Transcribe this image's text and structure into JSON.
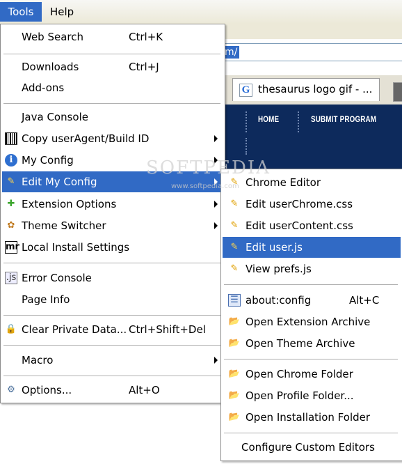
{
  "menubar": {
    "tools_label": "Tools",
    "help_label": "Help"
  },
  "background": {
    "url_fragment": "m/",
    "tab_label": "thesaurus logo gif - ...",
    "site_nav": [
      "HOME",
      "SUBMIT PROGRAM"
    ],
    "watermark": "SOFTPEDIA",
    "watermark_sub": "www.softpedia.com"
  },
  "tools_menu": {
    "items": [
      {
        "label": "Web Search",
        "shortcut": "Ctrl+K",
        "icon": "none"
      },
      {
        "label": "Downloads",
        "shortcut": "Ctrl+J",
        "icon": "none"
      },
      {
        "label": "Add-ons",
        "shortcut": "",
        "icon": "none"
      },
      {
        "label": "Java Console",
        "shortcut": "",
        "icon": "none"
      },
      {
        "label": "Copy userAgent/Build ID",
        "shortcut": "",
        "icon": "barcode-icon",
        "submenu": true
      },
      {
        "label": "My Config",
        "shortcut": "",
        "icon": "info-icon",
        "submenu": true
      },
      {
        "label": "Edit My Config",
        "shortcut": "",
        "icon": "pencil-icon",
        "submenu": true,
        "highlighted": true
      },
      {
        "label": "Extension Options",
        "shortcut": "",
        "icon": "puzzle-icon",
        "submenu": true
      },
      {
        "label": "Theme Switcher",
        "shortcut": "",
        "icon": "palette-icon",
        "submenu": true
      },
      {
        "label": "Local Install Settings",
        "shortcut": "",
        "icon": "mr-icon"
      },
      {
        "label": "Error Console",
        "shortcut": "",
        "icon": "js-console-icon"
      },
      {
        "label": "Page Info",
        "shortcut": "",
        "icon": "none"
      },
      {
        "label": "Clear Private Data...",
        "shortcut": "Ctrl+Shift+Del",
        "icon": "lock-icon"
      },
      {
        "label": "Macro",
        "shortcut": "",
        "icon": "none",
        "submenu": true
      },
      {
        "label": "Options...",
        "shortcut": "Alt+O",
        "icon": "gears-icon"
      }
    ]
  },
  "edit_config_submenu": {
    "items": [
      {
        "label": "Chrome Editor",
        "shortcut": "",
        "icon": "pencil-icon"
      },
      {
        "label": "Edit userChrome.css",
        "shortcut": "",
        "icon": "pencil-icon"
      },
      {
        "label": "Edit userContent.css",
        "shortcut": "",
        "icon": "pencil-icon"
      },
      {
        "label": "Edit user.js",
        "shortcut": "",
        "icon": "pencil-icon",
        "highlighted": true
      },
      {
        "label": "View prefs.js",
        "shortcut": "",
        "icon": "pencil-icon"
      },
      {
        "label": "about:config",
        "shortcut": "Alt+C",
        "icon": "list-icon"
      },
      {
        "label": "Open Extension Archive",
        "shortcut": "",
        "icon": "folder-icon"
      },
      {
        "label": "Open Theme Archive",
        "shortcut": "",
        "icon": "folder-icon"
      },
      {
        "label": "Open Chrome Folder",
        "shortcut": "",
        "icon": "folder-icon"
      },
      {
        "label": "Open Profile Folder...",
        "shortcut": "",
        "icon": "folder-icon"
      },
      {
        "label": "Open Installation Folder",
        "shortcut": "",
        "icon": "folder-icon"
      },
      {
        "label": "Configure Custom Editors",
        "shortcut": "",
        "icon": "none"
      }
    ]
  },
  "colors": {
    "highlight": "#316ac5",
    "site_nav_bg": "#0d2a5c",
    "menubar_bg": "#ece9d8"
  }
}
